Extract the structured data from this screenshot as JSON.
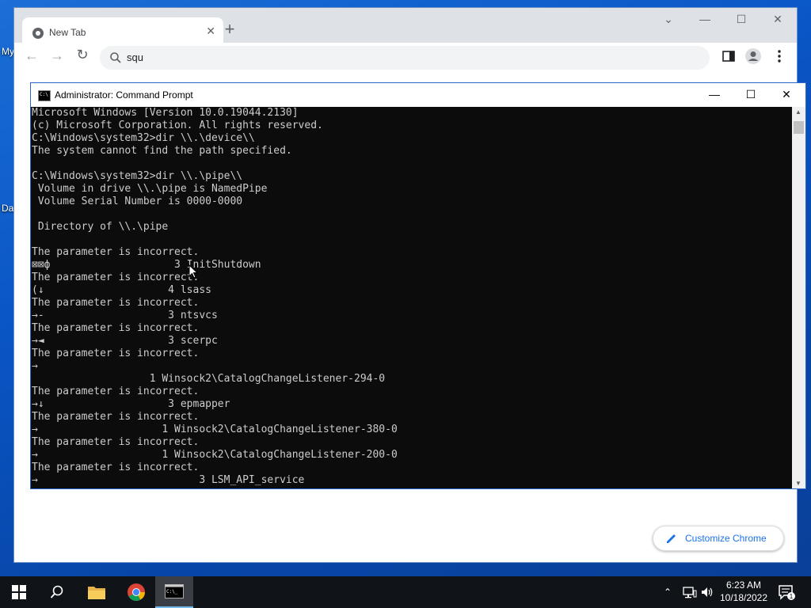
{
  "desktop": {
    "labels": [
      "My",
      "Da"
    ]
  },
  "browser": {
    "tab_title": "New Tab",
    "tab_close": "✕",
    "new_tab": "+",
    "window_controls": {
      "tab_search": "⌄",
      "minimize": "—",
      "maximize": "☐",
      "close": "✕"
    },
    "omnibox_text": "squ",
    "customize_label": "Customize Chrome"
  },
  "cmd": {
    "title": "Administrator: Command Prompt",
    "icon_text": "C:\\",
    "controls": {
      "minimize": "—",
      "maximize": "☐",
      "close": "✕"
    },
    "lines": [
      "Microsoft Windows [Version 10.0.19044.2130]",
      "(c) Microsoft Corporation. All rights reserved.",
      "C:\\Windows\\system32>dir \\\\.\\device\\\\",
      "The system cannot find the path specified.",
      "",
      "C:\\Windows\\system32>dir \\\\.\\pipe\\\\",
      " Volume in drive \\\\.\\pipe is NamedPipe",
      " Volume Serial Number is 0000-0000",
      "",
      " Directory of \\\\.\\pipe",
      "",
      "The parameter is incorrect.",
      "⊠⊠ф                    3 InitShutdown",
      "The parameter is incorrect.",
      "(↓                    4 lsass",
      "The parameter is incorrect.",
      "→-                    3 ntsvcs",
      "The parameter is incorrect.",
      "→◄                    3 scerpc",
      "The parameter is incorrect.",
      "→",
      "                   1 Winsock2\\CatalogChangeListener-294-0",
      "The parameter is incorrect.",
      "→↓                    3 epmapper",
      "The parameter is incorrect.",
      "→                    1 Winsock2\\CatalogChangeListener-380-0",
      "The parameter is incorrect.",
      "→                    1 Winsock2\\CatalogChangeListener-200-0",
      "The parameter is incorrect.",
      "→                          3 LSM_API_service"
    ]
  },
  "taskbar": {
    "time": "6:23 AM",
    "date": "10/18/2022",
    "notification_count": "1"
  }
}
